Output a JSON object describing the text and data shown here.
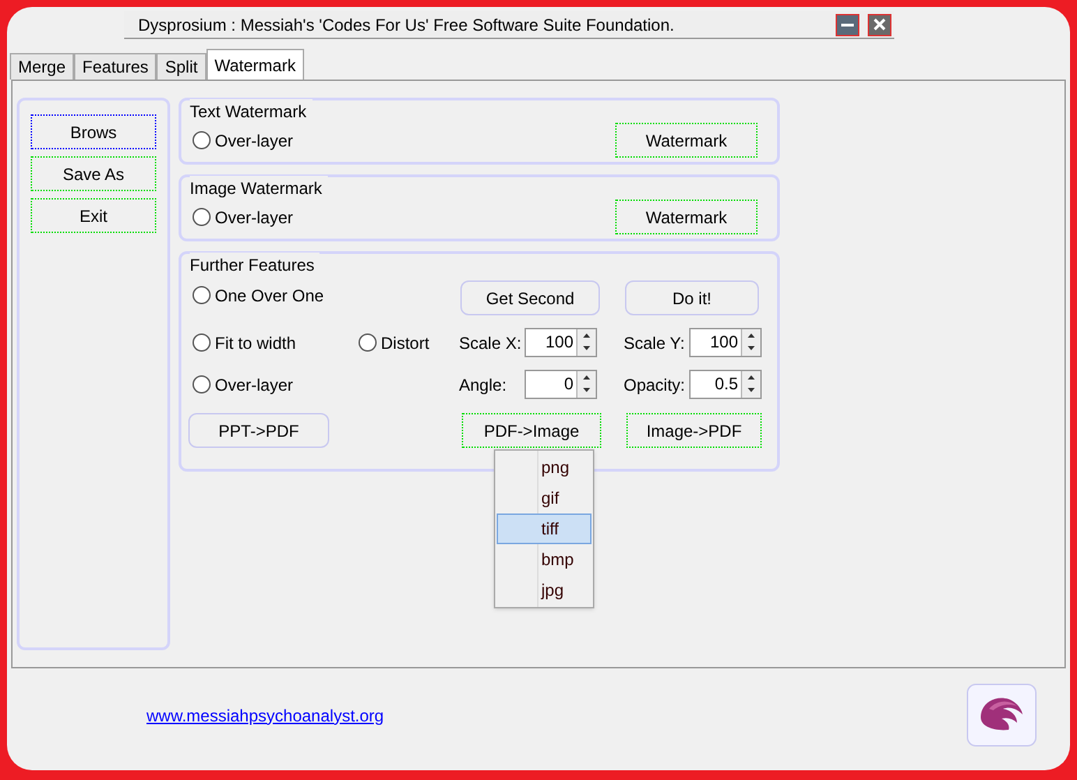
{
  "window": {
    "title": "Dysprosium : Messiah's 'Codes For Us' Free Software Suite Foundation."
  },
  "tabs": [
    {
      "label": "Merge",
      "selected": false
    },
    {
      "label": "Features",
      "selected": false
    },
    {
      "label": "Split",
      "selected": false
    },
    {
      "label": "Watermark",
      "selected": true
    }
  ],
  "sidebar": {
    "buttons": [
      {
        "label": "Brows",
        "kind": "focused"
      },
      {
        "label": "Save As",
        "kind": "dotted"
      },
      {
        "label": "Exit",
        "kind": "dotted"
      }
    ]
  },
  "text_watermark": {
    "title": "Text Watermark",
    "radio": {
      "label": "Over-layer",
      "selected": false
    },
    "button": {
      "label": "Watermark",
      "kind": "dotted"
    }
  },
  "image_watermark": {
    "title": "Image Watermark",
    "radio": {
      "label": "Over-layer",
      "selected": false
    },
    "button": {
      "label": "Watermark",
      "kind": "dotted"
    }
  },
  "further_features": {
    "title": "Further Features",
    "radios": [
      {
        "label": "One Over One",
        "selected": false
      },
      {
        "label": "Fit to width",
        "selected": false
      },
      {
        "label": "Distort",
        "selected": false
      },
      {
        "label": "Over-layer",
        "selected": false
      }
    ],
    "buttons_top": [
      {
        "label": "Get Second",
        "kind": "plain"
      },
      {
        "label": "Do it!",
        "kind": "plain"
      }
    ],
    "spinners": [
      {
        "label": "Scale X:",
        "value": "100"
      },
      {
        "label": "Scale Y:",
        "value": "100"
      },
      {
        "label": "Angle:",
        "value": "0"
      },
      {
        "label": "Opacity:",
        "value": "0.5"
      }
    ],
    "buttons_bottom": [
      {
        "label": "PPT->PDF",
        "kind": "plain"
      },
      {
        "label": "PDF->Image",
        "kind": "dotted"
      },
      {
        "label": "Image->PDF",
        "kind": "dotted"
      }
    ]
  },
  "dropdown": {
    "items": [
      {
        "label": "png",
        "selected": false
      },
      {
        "label": "gif",
        "selected": false
      },
      {
        "label": "tiff",
        "selected": true
      },
      {
        "label": "bmp",
        "selected": false
      },
      {
        "label": "jpg",
        "selected": false
      }
    ]
  },
  "footer": {
    "link": "www.messiahpsychoanalyst.org"
  }
}
